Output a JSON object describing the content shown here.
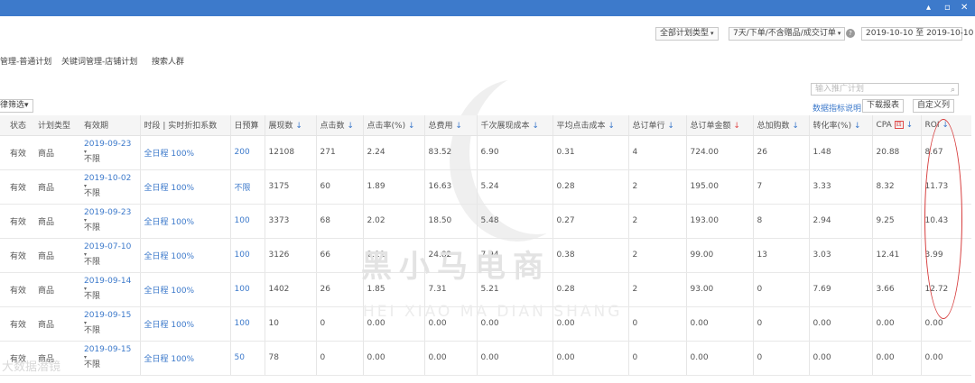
{
  "titlebar": {
    "minimize": "▴",
    "restore": "▫",
    "close": "✕"
  },
  "filters": {
    "plan_type": "全部计划类型",
    "attribution": "7天/下单/不含赠品/成交订单",
    "help": "?",
    "date_start": "2019-10-10",
    "date_sep": "至",
    "date_end": "2019-10-10"
  },
  "tabs": [
    "管理-普通计划",
    "关键词管理-店铺计划",
    "搜索人群"
  ],
  "subbar": {
    "filter_btn": "律筛选",
    "search_placeholder": "输入推广计划",
    "explain_link": "数据指标说明 >",
    "download": "下载报表",
    "custom": "自定义列"
  },
  "table": {
    "headers": [
      "状态",
      "计划类型",
      "有效期",
      "时段 | 实时折扣系数",
      "日预算",
      "展现数",
      "点击数",
      "点击率(%)",
      "总费用",
      "千次展现成本",
      "平均点击成本",
      "总订单行",
      "总订单金额",
      "总加购数",
      "转化率(%)",
      "CPA",
      "ROI"
    ],
    "cpa_badge": "四",
    "rows": [
      {
        "status": "有效",
        "type": "商品",
        "date": "2019-09-23",
        "end": "不限",
        "slot": "全日程 100%",
        "budget": "200",
        "impressions": "12108",
        "clicks": "271",
        "ctr": "2.24",
        "cost": "83.52",
        "cpm": "6.90",
        "cpc": "0.31",
        "orders": "4",
        "amount": "724.00",
        "carts": "26",
        "cvr": "1.48",
        "cpa": "20.88",
        "roi": "8.67"
      },
      {
        "status": "有效",
        "type": "商品",
        "date": "2019-10-02",
        "end": "不限",
        "slot": "全日程 100%",
        "budget": "不限",
        "impressions": "3175",
        "clicks": "60",
        "ctr": "1.89",
        "cost": "16.63",
        "cpm": "5.24",
        "cpc": "0.28",
        "orders": "2",
        "amount": "195.00",
        "carts": "7",
        "cvr": "3.33",
        "cpa": "8.32",
        "roi": "11.73"
      },
      {
        "status": "有效",
        "type": "商品",
        "date": "2019-09-23",
        "end": "不限",
        "slot": "全日程 100%",
        "budget": "100",
        "impressions": "3373",
        "clicks": "68",
        "ctr": "2.02",
        "cost": "18.50",
        "cpm": "5.48",
        "cpc": "0.27",
        "orders": "2",
        "amount": "193.00",
        "carts": "8",
        "cvr": "2.94",
        "cpa": "9.25",
        "roi": "10.43"
      },
      {
        "status": "有效",
        "type": "商品",
        "date": "2019-07-10",
        "end": "不限",
        "slot": "全日程 100%",
        "budget": "100",
        "impressions": "3126",
        "clicks": "66",
        "ctr": "2.11",
        "cost": "24.82",
        "cpm": "7.94",
        "cpc": "0.38",
        "orders": "2",
        "amount": "99.00",
        "carts": "13",
        "cvr": "3.03",
        "cpa": "12.41",
        "roi": "3.99"
      },
      {
        "status": "有效",
        "type": "商品",
        "date": "2019-09-14",
        "end": "不限",
        "slot": "全日程 100%",
        "budget": "100",
        "impressions": "1402",
        "clicks": "26",
        "ctr": "1.85",
        "cost": "7.31",
        "cpm": "5.21",
        "cpc": "0.28",
        "orders": "2",
        "amount": "93.00",
        "carts": "0",
        "cvr": "7.69",
        "cpa": "3.66",
        "roi": "12.72"
      },
      {
        "status": "有效",
        "type": "商品",
        "date": "2019-09-15",
        "end": "不限",
        "slot": "全日程 100%",
        "budget": "100",
        "impressions": "10",
        "clicks": "0",
        "ctr": "0.00",
        "cost": "0.00",
        "cpm": "0.00",
        "cpc": "0.00",
        "orders": "0",
        "amount": "0.00",
        "carts": "0",
        "cvr": "0.00",
        "cpa": "0.00",
        "roi": "0.00"
      },
      {
        "status": "有效",
        "type": "商品",
        "date": "2019-09-15",
        "end": "不限",
        "slot": "全日程 100%",
        "budget": "50",
        "impressions": "78",
        "clicks": "0",
        "ctr": "0.00",
        "cost": "0.00",
        "cpm": "0.00",
        "cpc": "0.00",
        "orders": "0",
        "amount": "0.00",
        "carts": "0",
        "cvr": "0.00",
        "cpa": "0.00",
        "roi": "0.00"
      }
    ]
  },
  "watermark": {
    "cn": "黑小马电商",
    "en": "HEI XIAO MA DIAN SHANG",
    "corner": "大数据潜镜"
  },
  "colors": {
    "titlebar": "#3d7acb",
    "link": "#3d7acb",
    "highlight": "#d63b3b"
  }
}
